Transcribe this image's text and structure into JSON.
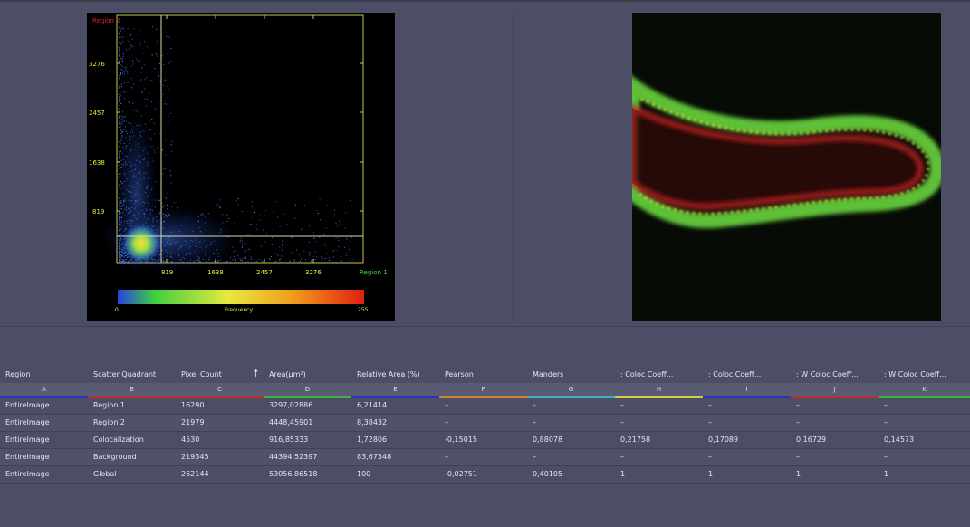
{
  "scatter": {
    "region2_label": "Region 2",
    "region1_label": "Region 1",
    "y_ticks": [
      "3276",
      "2457",
      "1638",
      "819"
    ],
    "x_ticks": [
      "819",
      "1638",
      "2457",
      "3276"
    ],
    "colorbar_min": "0",
    "colorbar_label": "Frequency",
    "colorbar_max": "255",
    "colors": {
      "axis": "#c8c84a",
      "region1": "#40d040",
      "region2": "#e02020"
    }
  },
  "table": {
    "columns": [
      {
        "header": "Region",
        "letter": "A",
        "accent": "#3030c0"
      },
      {
        "header": "Scatter Quadrant",
        "letter": "B",
        "accent": "#c03030"
      },
      {
        "header": "Pixel Count",
        "letter": "C",
        "accent": "#c03030",
        "sort_icon": "↑"
      },
      {
        "header": "Area(µm²)",
        "letter": "D",
        "accent": "#40b040"
      },
      {
        "header": "Relative Area (%)",
        "letter": "E",
        "accent": "#3030c0"
      },
      {
        "header": "Pearson",
        "letter": "F",
        "accent": "#d08030"
      },
      {
        "header": "Manders",
        "letter": "G",
        "accent": "#40b0c0"
      },
      {
        "header": ": Coloc Coeff...",
        "letter": "H",
        "accent": "#d0d040"
      },
      {
        "header": ": Coloc Coeff...",
        "letter": "I",
        "accent": "#3030c0"
      },
      {
        "header": ": W Coloc Coeff...",
        "letter": "J",
        "accent": "#c03030"
      },
      {
        "header": ": W Coloc Coeff...",
        "letter": "K",
        "accent": "#40b040"
      }
    ],
    "rows": [
      [
        "EntireImage",
        "Region 1",
        "16290",
        "3297,02886",
        "6,21414",
        "–",
        "–",
        "–",
        "–",
        "–",
        "–"
      ],
      [
        "EntireImage",
        "Region 2",
        "21979",
        "4448,45901",
        "8,38432",
        "–",
        "–",
        "–",
        "–",
        "–",
        "–"
      ],
      [
        "EntireImage",
        "Colocalization",
        "4530",
        "916,85333",
        "1,72806",
        "-0,15015",
        "0,88078",
        "0,21758",
        "0,17089",
        "0,16729",
        "0,14573"
      ],
      [
        "EntireImage",
        "Background",
        "219345",
        "44394,52397",
        "83,67348",
        "–",
        "–",
        "–",
        "–",
        "–",
        "–"
      ],
      [
        "EntireImage",
        "Global",
        "262144",
        "53056,86518",
        "100",
        "-0,02751",
        "0,40105",
        "1",
        "1",
        "1",
        "1"
      ]
    ]
  }
}
